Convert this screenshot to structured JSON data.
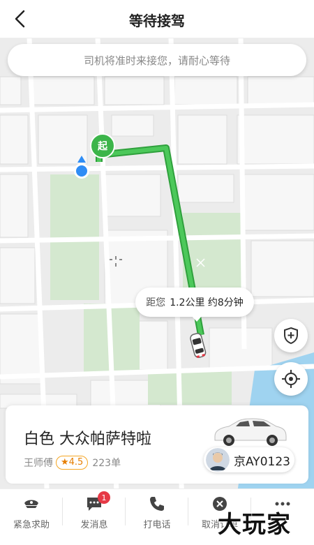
{
  "header": {
    "title": "等待接驾",
    "back_icon": "back-arrow-icon"
  },
  "map": {
    "notice": "司机将准时来接您，请耐心等待",
    "start_marker": "起",
    "eta_prefix": "距您",
    "eta_value": "1.2公里 约8分钟",
    "route_color": "#3cb54a",
    "location_dot_color": "#2f8df5"
  },
  "driver_card": {
    "car_description": "白色 大众帕萨特啦",
    "driver_name": "王师傅",
    "rating": "4.5",
    "orders": "223单",
    "plate": "京AY0123"
  },
  "actions": [
    {
      "label": "紧急求助",
      "icon": "police-cap-icon"
    },
    {
      "label": "发消息",
      "icon": "message-icon",
      "badge": "1"
    },
    {
      "label": "打电话",
      "icon": "phone-icon"
    },
    {
      "label": "取消订单",
      "icon": "cancel-icon"
    },
    {
      "label": "",
      "icon": "more-icon"
    }
  ],
  "watermark": "大玩家"
}
